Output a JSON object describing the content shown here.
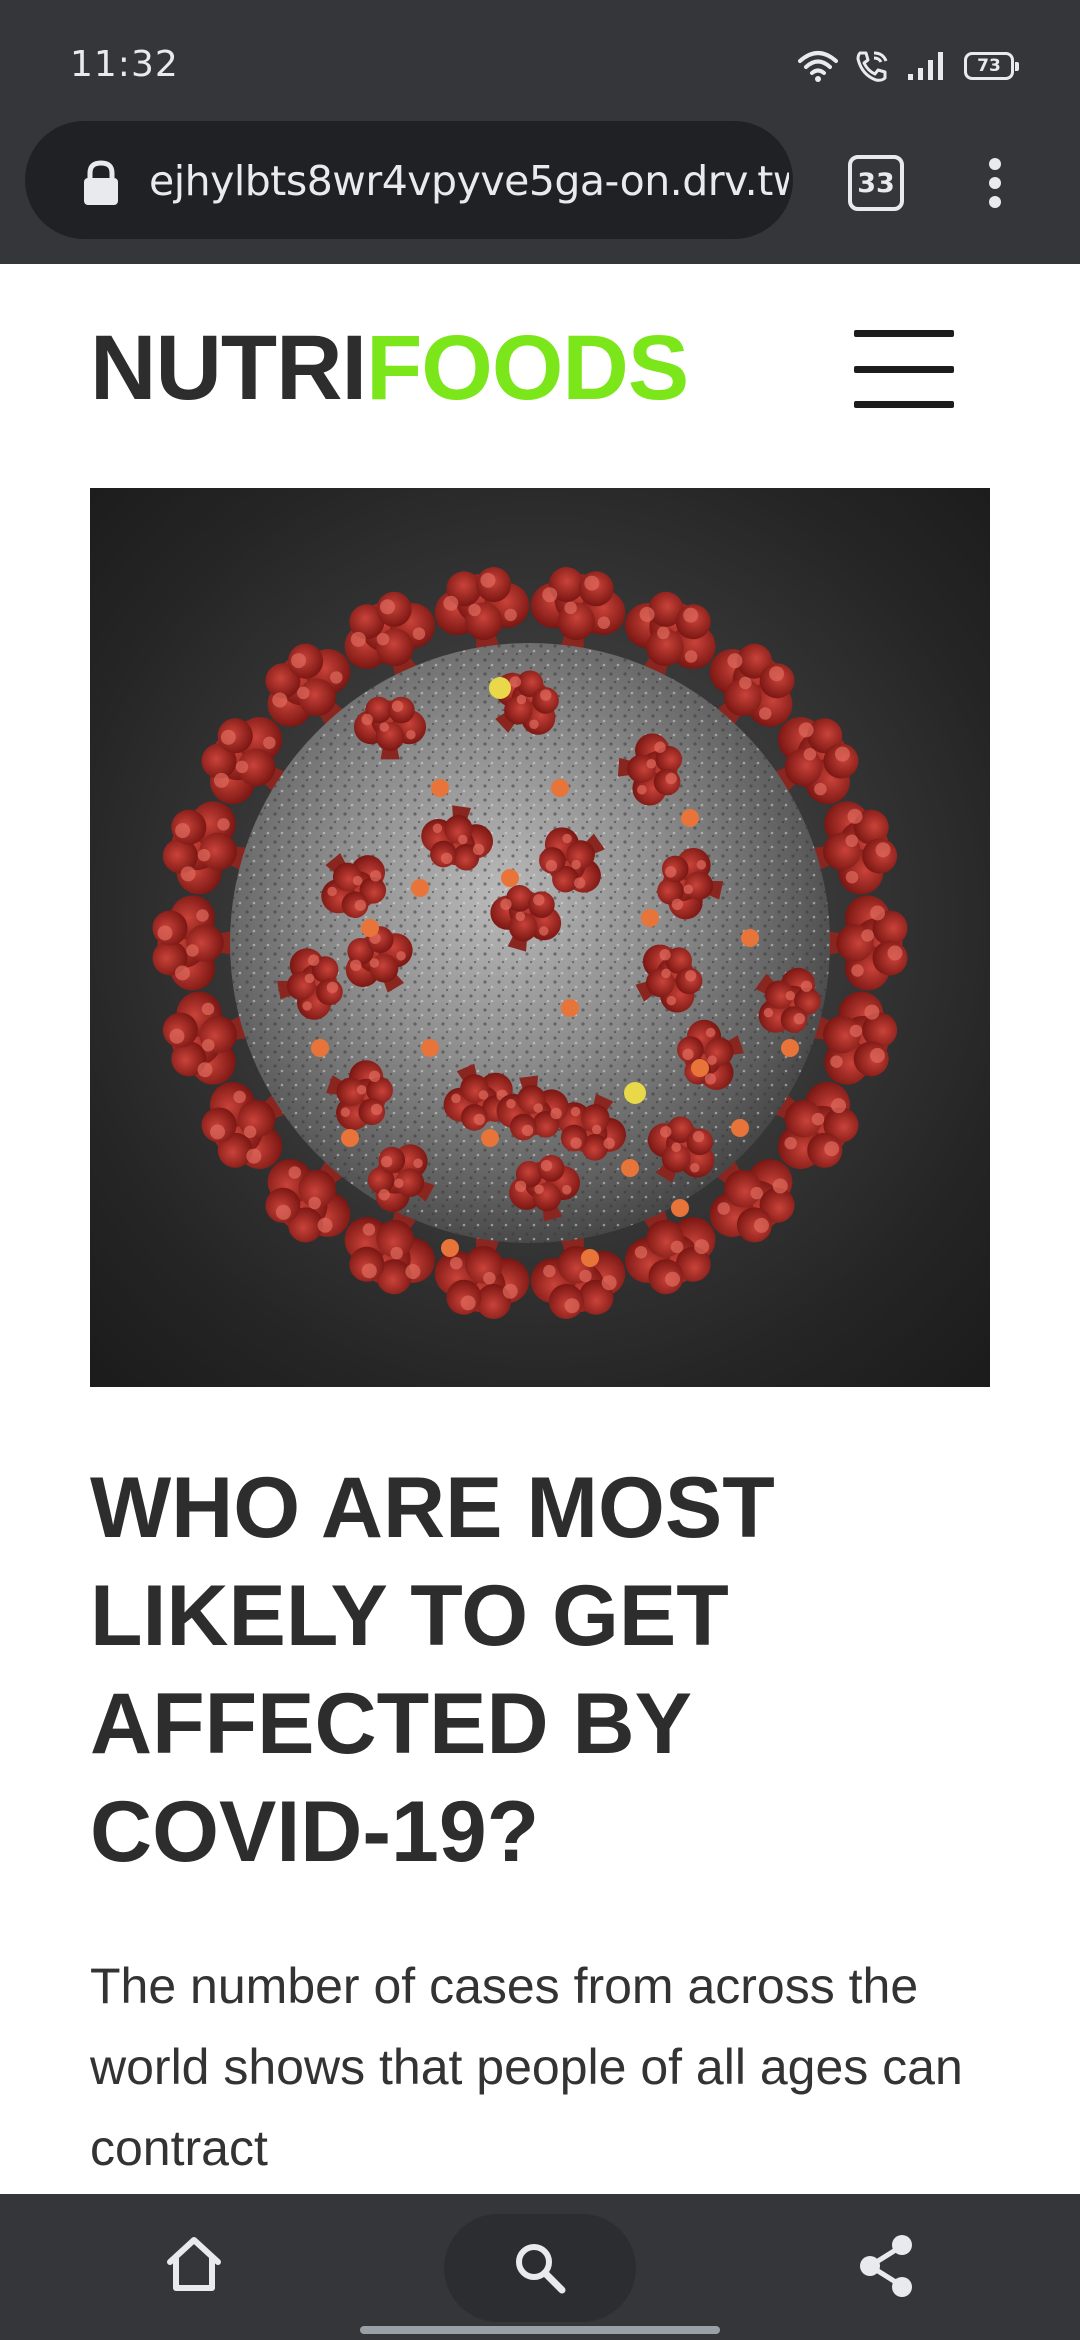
{
  "status_bar": {
    "time": "11:32",
    "battery": "73",
    "icons": [
      "wifi-icon",
      "wifi-calling-icon",
      "signal-icon",
      "battery-icon"
    ]
  },
  "browser": {
    "url": "ejhylbts8wr4vpyve5ga-on.drv.tw",
    "tab_count": "33",
    "icons": [
      "lock-icon",
      "tab-switcher-icon",
      "more-menu-icon"
    ]
  },
  "site": {
    "logo_part1": "NUTRI",
    "logo_part2": "FOODS",
    "brand_dark": "#2d2d2d",
    "brand_green": "#7be61a",
    "menu_icon": "hamburger-menu-icon"
  },
  "article": {
    "hero_image": "coronavirus-illustration",
    "title": "WHO ARE MOST LIKELY TO GET AFFECTED BY COVID-19?",
    "body": "The number of cases from across the world shows that people of all ages can contract"
  },
  "bottom_nav": {
    "icons": [
      "home-icon",
      "search-icon",
      "share-icon"
    ]
  },
  "colors": {
    "chrome_bar": "#35363a",
    "url_field": "#202124",
    "chrome_text": "#e8eaed"
  }
}
